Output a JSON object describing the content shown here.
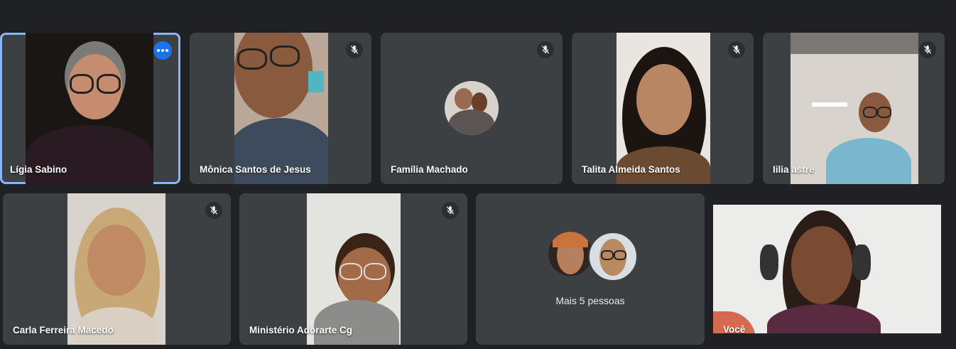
{
  "participants": [
    {
      "name": "Lígia Sabino",
      "muted": false,
      "active_speaker": true,
      "more_options_icon": "more-horiz-icon"
    },
    {
      "name": "Mônica Santos de Jesus",
      "muted": true
    },
    {
      "name": "Família Machado",
      "muted": true,
      "video": "off"
    },
    {
      "name": "Talita Almeida Santos",
      "muted": true
    },
    {
      "name": "Iilia astre",
      "muted": true
    },
    {
      "name": "Carla Ferreira Macedo",
      "muted": true
    },
    {
      "name": "Ministério Adorarte Cg",
      "muted": true
    }
  ],
  "overflow": {
    "label": "Mais 5 pessoas"
  },
  "self": {
    "name": "Você"
  },
  "icons": {
    "muted": "mic-off-icon",
    "more": "more-options-icon"
  },
  "colors": {
    "background": "#202124",
    "tile": "#3c4043",
    "active_border": "#8ab4f8",
    "more_button": "#1a73e8"
  }
}
